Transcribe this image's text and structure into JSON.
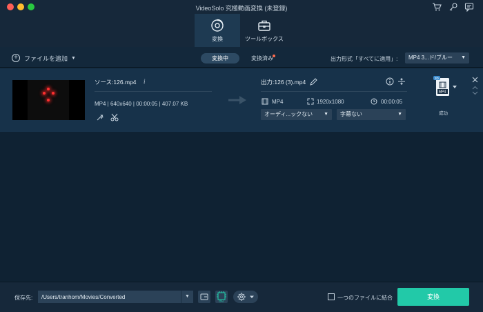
{
  "window": {
    "title": "VideoSolo 究極動画変換 (未登録)"
  },
  "mode_tabs": [
    {
      "label": "変換",
      "icon": "convert-disc-icon",
      "active": true
    },
    {
      "label": "ツールボックス",
      "icon": "toolbox-icon",
      "active": false
    }
  ],
  "toolbar": {
    "add_file_label": "ファイルを追加",
    "seg_converting": "変換中",
    "seg_converted": "変換済み",
    "format_label": "出力形式「すべてに適用」:",
    "format_value": "MP4 3...ド/ブルー"
  },
  "file": {
    "source_name": "ソース:126.mp4",
    "source_meta": "MP4 | 640x640 | 00:00:05 | 407.07 KB",
    "output_name": "出力:126 (3).mp4",
    "output_format": "MP4",
    "output_resolution": "1920x1080",
    "output_duration": "00:00:05",
    "audio_track": "オーディ...ックない",
    "subtitle": "字幕ない",
    "badge_top": "3D",
    "badge_format": "MP4",
    "status": "成功"
  },
  "bottom": {
    "save_label": "保存先:",
    "save_path": "/Users/tranhom/Movies/Converted",
    "gpu_label": "ON",
    "merge_label": "一つのファイルに結合",
    "convert_label": "変換"
  },
  "colors": {
    "background": "#0f2233",
    "panel": "#16283a",
    "row": "#17324a",
    "accent": "#22c9a8",
    "notify_dot": "#ff6b4d"
  }
}
